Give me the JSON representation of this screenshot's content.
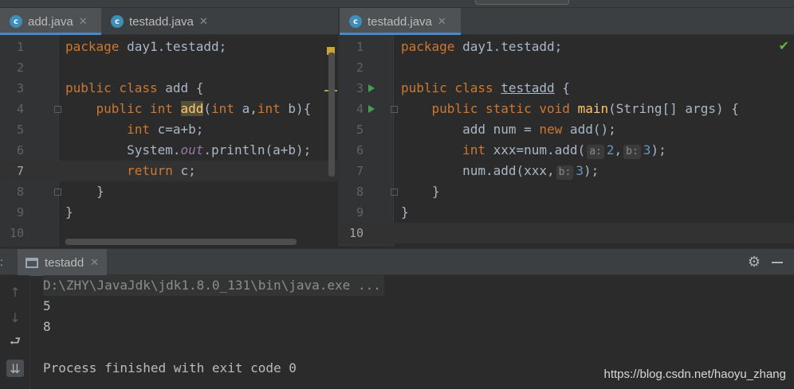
{
  "left_editor": {
    "tabs": [
      {
        "icon": "c",
        "label": "add.java",
        "close": "✕"
      },
      {
        "icon": "c",
        "label": "testadd.java",
        "close": "✕"
      }
    ],
    "line_numbers": [
      "1",
      "2",
      "3",
      "4",
      "5",
      "6",
      "7",
      "8",
      "9",
      "10"
    ],
    "current_line": "7",
    "code": {
      "l1_kw": "package",
      "l1_rest": " day1.testadd;",
      "l3_kw": "public class",
      "l3_rest": " add {",
      "l4_kw1": "public int",
      "l4_fn": "add",
      "l4_p1": "(",
      "l4_kw2": "int",
      "l4_p2": " a,",
      "l4_kw3": "int",
      "l4_p3": " b){",
      "l5_kw": "int",
      "l5_rest": " c=a+b;",
      "l6_a": "System.",
      "l6_out": "out",
      "l6_b": ".println(a+b);",
      "l7_kw": "return",
      "l7_rest": " c;",
      "l8": "}",
      "l9": "}"
    }
  },
  "right_editor": {
    "tabs": [
      {
        "icon": "c",
        "label": "testadd.java",
        "close": "✕"
      }
    ],
    "line_numbers": [
      "1",
      "2",
      "3",
      "4",
      "5",
      "6",
      "7",
      "8",
      "9",
      "10"
    ],
    "current_line": "10",
    "code": {
      "l1_kw": "package",
      "l1_rest": " day1.testadd;",
      "l3_kw": "public class",
      "l3_cls": "testadd",
      "l3_rest": " {",
      "l4_kw": "public static void",
      "l4_fn": "main",
      "l4_rest": "(String[] args) {",
      "l5_a": "add num = ",
      "l5_kw": "new",
      "l5_b": " add();",
      "l6_kw": "int",
      "l6_a": " xxx=num.add(",
      "l6_h1": "a:",
      "l6_n1": "2",
      "l6_c": ",",
      "l6_h2": "b:",
      "l6_n2": "3",
      "l6_d": ");",
      "l7_a": "num.add(xxx,",
      "l7_h": "b:",
      "l7_n": "3",
      "l7_b": ");",
      "l8": "}",
      "l9": "}"
    }
  },
  "run_panel": {
    "side_label": ":",
    "tab_label": "testadd",
    "tab_close": "✕",
    "gear_icon": "⚙",
    "tools": [
      "↑",
      "↓",
      "⮐",
      "⇊"
    ],
    "console": {
      "command": "D:\\ZHY\\JavaJdk\\jdk1.8.0_131\\bin\\java.exe ...",
      "out1": "5",
      "out2": "8",
      "finish": "Process finished with exit code 0"
    },
    "watermark": "https://blog.csdn.net/haoyu_zhang"
  },
  "colors": {
    "editor_bg": "#2b2b2b",
    "keyword": "#cc7832",
    "method": "#ffc66d",
    "number": "#6897bb",
    "static_field": "#9876aa",
    "run_gutter": "#499c54",
    "tab_underline": "#4a88c7"
  }
}
